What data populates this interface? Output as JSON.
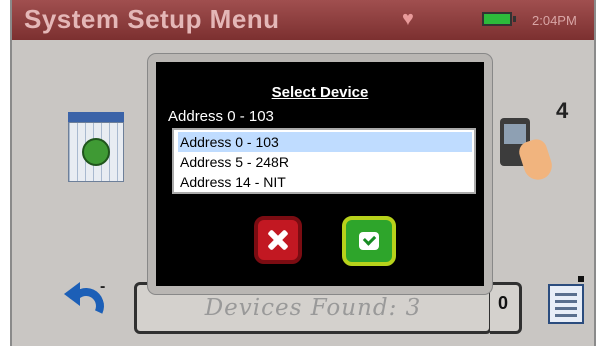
{
  "header": {
    "title": "System Setup Menu",
    "time": "2:04PM"
  },
  "background": {
    "side_number": "4",
    "devices_found": "Devices Found: 3",
    "zero_value": "0"
  },
  "dialog": {
    "title": "Select Device",
    "selected": "Address  0 - 103",
    "items": [
      "Address  0 - 103",
      "Address  5 - 248R",
      "Address 14 - NIT"
    ]
  },
  "colors": {
    "title_bar": "#8c3b3b",
    "cancel": "#c21822",
    "ok": "#2ea52b",
    "selection": "#bfdcff"
  },
  "icons": {
    "calendar": "calendar-clock-icon",
    "keypad": "hand-keypad-icon",
    "back": "back-arrow-icon",
    "document": "document-list-icon",
    "battery": "battery-icon"
  }
}
